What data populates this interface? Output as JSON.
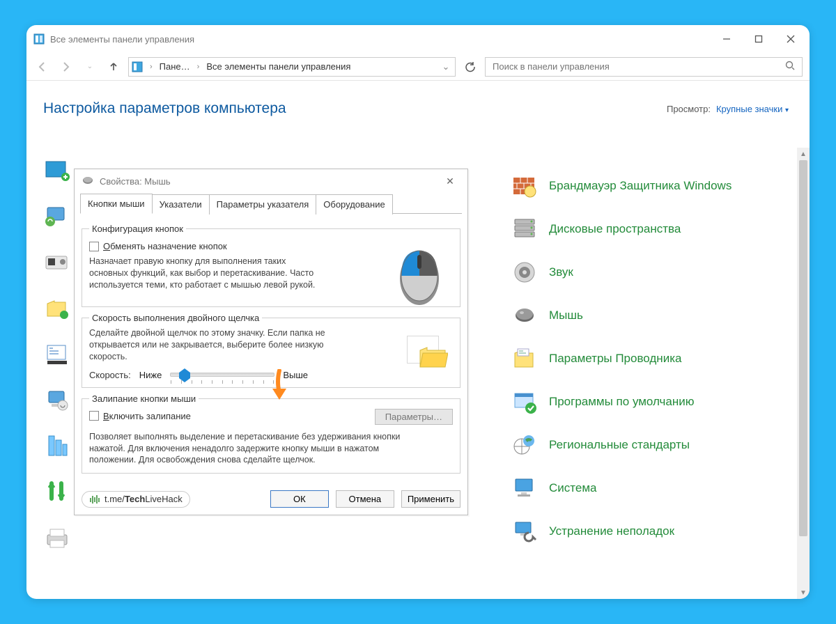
{
  "window": {
    "title": "Все элементы панели управления"
  },
  "addr": {
    "crumb1": "Пане…",
    "crumb2": "Все элементы панели управления"
  },
  "search": {
    "placeholder": "Поиск в панели управления"
  },
  "header": {
    "title": "Настройка параметров компьютера",
    "view_label": "Просмотр:",
    "view_value": "Крупные значки"
  },
  "cp_items": [
    "Брандмауэр Защитника Windows",
    "Дисковые пространства",
    "Звук",
    "Мышь",
    "Параметры Проводника",
    "Программы по умолчанию",
    "Региональные стандарты",
    "Система",
    "Устранение неполадок"
  ],
  "dialog": {
    "title": "Свойства: Мышь",
    "tabs": [
      "Кнопки мыши",
      "Указатели",
      "Параметры указателя",
      "Оборудование"
    ],
    "grp1": {
      "legend": "Конфигурация кнопок",
      "checkbox": "Обменять назначение кнопок",
      "desc": "Назначает правую кнопку для выполнения таких основных функций, как выбор и перетаскивание. Часто используется теми, кто работает с мышью левой рукой."
    },
    "grp2": {
      "legend": "Скорость выполнения двойного щелчка",
      "desc": "Сделайте двойной щелчок по этому значку. Если папка не открывается или не закрывается, выберите более низкую скорость.",
      "speed_label": "Скорость:",
      "low": "Ниже",
      "high": "Выше"
    },
    "grp3": {
      "legend": "Залипание кнопки мыши",
      "checkbox": "Включить залипание",
      "params_btn": "Параметры…",
      "desc": "Позволяет выполнять выделение и перетаскивание без удерживания кнопки нажатой. Для включения ненадолго задержите кнопку мыши в нажатом положении. Для освобождения снова сделайте щелчок."
    },
    "footer": {
      "badge_prefix": "t.me/",
      "badge_bold1": "Tech",
      "badge_rest": "LiveHack",
      "ok": "ОК",
      "cancel": "Отмена",
      "apply": "Применить"
    }
  }
}
